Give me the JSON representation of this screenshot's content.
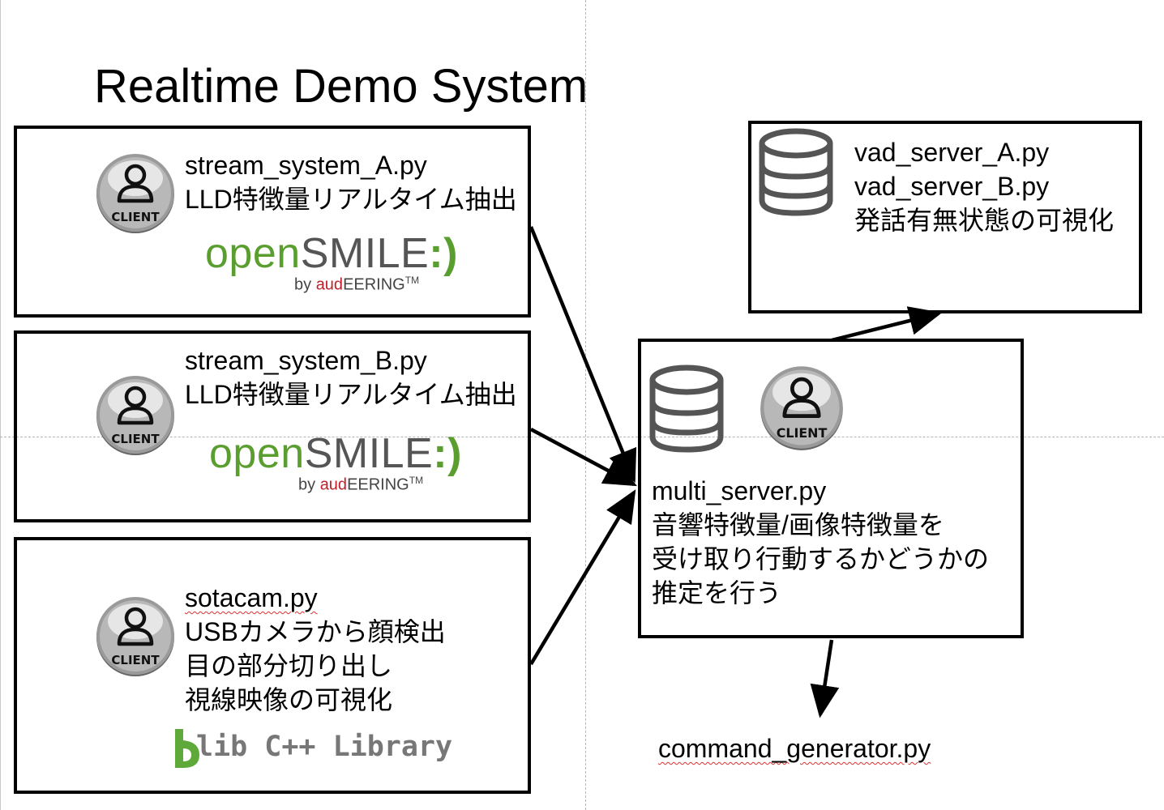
{
  "title": "Realtime Demo System",
  "client_icon_label": "CLIENT",
  "boxes": {
    "stream_a": {
      "lines": [
        "stream_system_A.py",
        "LLD特徴量リアルタイム抽出"
      ],
      "logo": {
        "name": "opensmile-logo",
        "open": "open",
        "smile": "SMILE",
        "face": ":)",
        "by": "by ",
        "aud": "aud",
        "eering": "EERING",
        "tm": "TM"
      }
    },
    "stream_b": {
      "lines": [
        "stream_system_B.py",
        "LLD特徴量リアルタイム抽出"
      ],
      "logo": {
        "name": "opensmile-logo",
        "open": "open",
        "smile": "SMILE",
        "face": ":)",
        "by": "by ",
        "aud": "aud",
        "eering": "EERING",
        "tm": "TM"
      }
    },
    "sotacam": {
      "lines": [
        "sotacam.py",
        "USBカメラから顔検出",
        "目の部分切り出し",
        "視線映像の可視化"
      ],
      "logo": {
        "name": "dlib-logo",
        "text": "lib C++ Library"
      }
    },
    "vad_server": {
      "lines": [
        "vad_server_A.py",
        "vad_server_B.py",
        "発話有無状態の可視化"
      ]
    },
    "multi_server": {
      "lines": [
        "multi_server.py",
        "音響特徴量/画像特徴量を",
        "受け取り行動するかどうかの",
        "推定を行う"
      ]
    }
  },
  "command_generator": "command_generator.py",
  "icons": [
    "client-icon",
    "database-icon"
  ]
}
